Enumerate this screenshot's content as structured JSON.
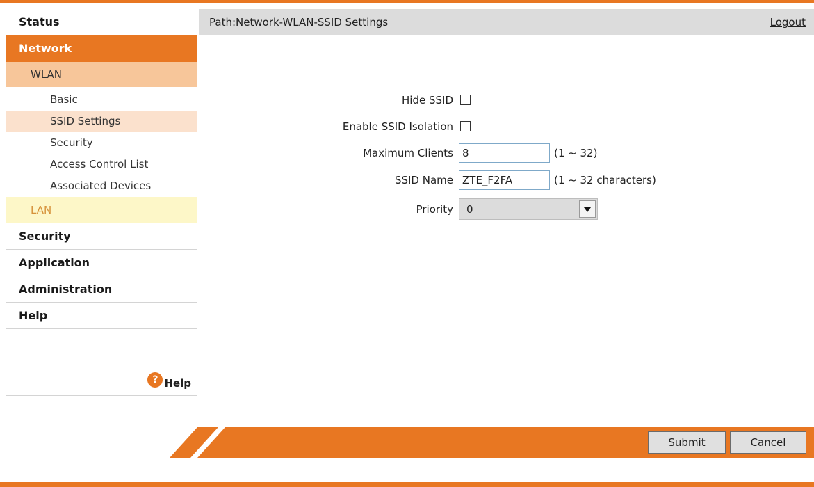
{
  "header": {
    "path": "Path:Network-WLAN-SSID Settings",
    "logout": "Logout"
  },
  "sidebar": {
    "status": "Status",
    "network": "Network",
    "wlan": "WLAN",
    "wlan_items": [
      "Basic",
      "SSID Settings",
      "Security",
      "Access Control List",
      "Associated Devices"
    ],
    "lan": "LAN",
    "security": "Security",
    "application": "Application",
    "administration": "Administration",
    "help": "Help",
    "help_link": "Help",
    "help_icon_glyph": "?"
  },
  "form": {
    "hide_ssid_label": "Hide SSID",
    "hide_ssid_checked": false,
    "isolation_label": "Enable SSID Isolation",
    "isolation_checked": false,
    "max_clients_label": "Maximum Clients",
    "max_clients_value": "8",
    "max_clients_hint": "(1 ~ 32)",
    "ssid_name_label": "SSID Name",
    "ssid_name_value": "ZTE_F2FA",
    "ssid_name_hint": "(1 ~ 32 characters)",
    "priority_label": "Priority",
    "priority_value": "0"
  },
  "actions": {
    "submit": "Submit",
    "cancel": "Cancel"
  },
  "colors": {
    "accent": "#e87722",
    "selected_item_bg": "#fbe1cd",
    "wlan_bg": "#f7c69a",
    "lan_bg": "#fdf7c8"
  }
}
